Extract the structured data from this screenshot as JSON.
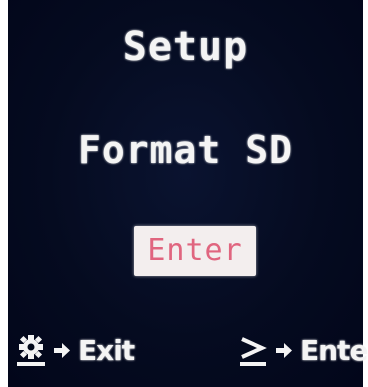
{
  "screen": {
    "title": "Setup",
    "item_label": "Format SD",
    "enter_button_label": "Enter",
    "colors": {
      "background": "#03091a",
      "text": "#f4f4f4",
      "button_bg": "#f3eeee",
      "button_text": "#e0657f"
    }
  },
  "footer": {
    "left": {
      "icon": "gear-icon",
      "label": "Exit"
    },
    "right": {
      "icon": "greater-than-icon",
      "label": "Enter"
    }
  }
}
